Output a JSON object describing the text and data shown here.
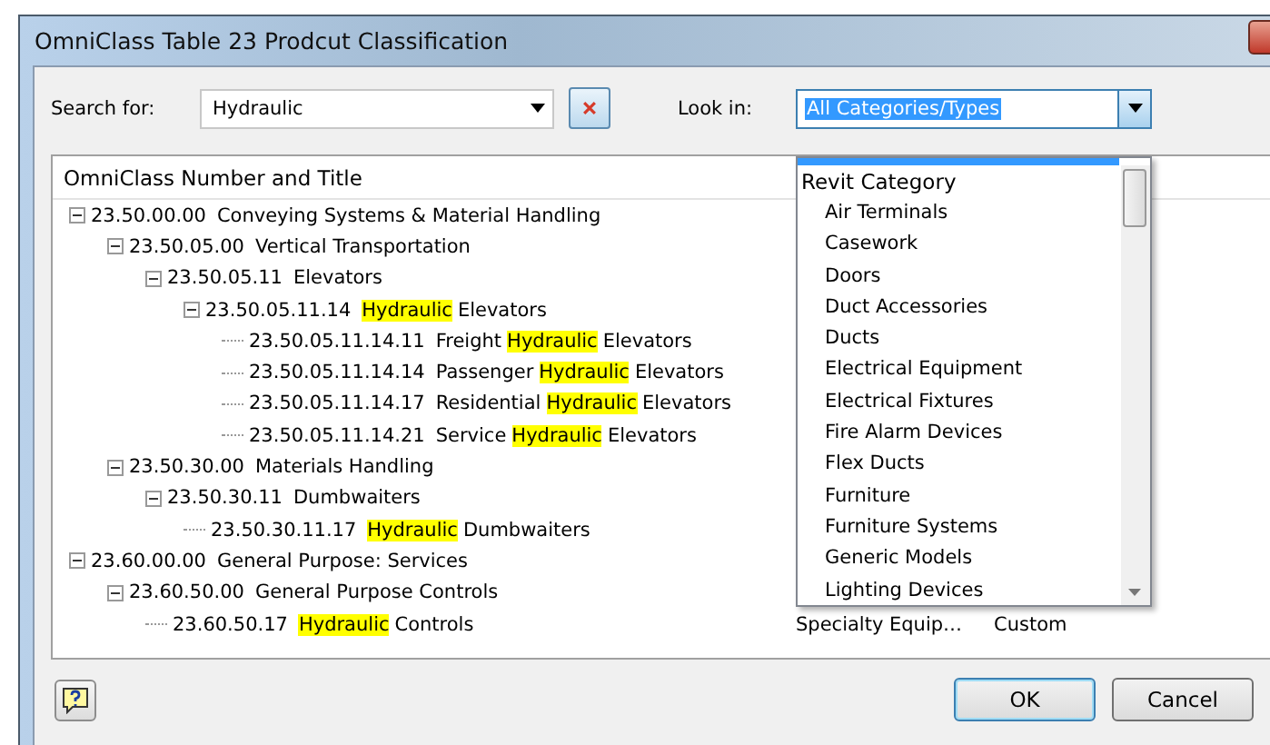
{
  "window": {
    "title": "OmniClass Table 23 Prodcut Classification"
  },
  "search": {
    "label": "Search for:",
    "value": "Hydraulic"
  },
  "look_in": {
    "label": "Look in:",
    "value": "All Categories/Types",
    "expanded": true
  },
  "tree": {
    "columns": [
      "OmniClass Number and Title"
    ],
    "items": [
      {
        "number": "23.50.00.00",
        "title": [
          {
            "text": "Conveying Systems & Material Handling",
            "highlighted": false
          }
        ],
        "expanded": true,
        "children": [
          {
            "number": "23.50.05.00",
            "title": [
              {
                "text": "Vertical Transportation",
                "highlighted": false
              }
            ],
            "expanded": true,
            "children": [
              {
                "number": "23.50.05.11",
                "title": [
                  {
                    "text": "Elevators",
                    "highlighted": false
                  }
                ],
                "expanded": true,
                "children": [
                  {
                    "number": "23.50.05.11.14",
                    "title": [
                      {
                        "text": "Hydraulic",
                        "highlighted": true
                      },
                      {
                        "text": "Elevators",
                        "highlighted": false
                      }
                    ],
                    "expanded": true,
                    "children": [
                      {
                        "number": "23.50.05.11.14.11",
                        "title": [
                          {
                            "text": "Freight",
                            "highlighted": false
                          },
                          {
                            "text": "Hydraulic",
                            "highlighted": true
                          },
                          {
                            "text": "Elevators",
                            "highlighted": false
                          }
                        ]
                      },
                      {
                        "number": "23.50.05.11.14.14",
                        "title": [
                          {
                            "text": "Passenger",
                            "highlighted": false
                          },
                          {
                            "text": "Hydraulic",
                            "highlighted": true
                          },
                          {
                            "text": "Elevators",
                            "highlighted": false
                          }
                        ]
                      },
                      {
                        "number": "23.50.05.11.14.17",
                        "title": [
                          {
                            "text": "Residential",
                            "highlighted": false
                          },
                          {
                            "text": "Hydraulic",
                            "highlighted": true
                          },
                          {
                            "text": "Elevators",
                            "highlighted": false
                          }
                        ]
                      },
                      {
                        "number": "23.50.05.11.14.21",
                        "title": [
                          {
                            "text": "Service",
                            "highlighted": false
                          },
                          {
                            "text": "Hydraulic",
                            "highlighted": true
                          },
                          {
                            "text": "Elevators",
                            "highlighted": false
                          }
                        ]
                      }
                    ]
                  }
                ]
              }
            ]
          },
          {
            "number": "23.50.30.00",
            "title": [
              {
                "text": "Materials Handling",
                "highlighted": false
              }
            ],
            "expanded": true,
            "children": [
              {
                "number": "23.50.30.11",
                "title": [
                  {
                    "text": "Dumbwaiters",
                    "highlighted": false
                  }
                ],
                "expanded": true,
                "children": [
                  {
                    "number": "23.50.30.11.17",
                    "title": [
                      {
                        "text": "Hydraulic",
                        "highlighted": true
                      },
                      {
                        "text": "Dumbwaiters",
                        "highlighted": false
                      }
                    ]
                  }
                ]
              }
            ]
          }
        ]
      },
      {
        "number": "23.60.00.00",
        "title": [
          {
            "text": "General Purpose: Services",
            "highlighted": false
          }
        ],
        "expanded": true,
        "children": [
          {
            "number": "23.60.50.00",
            "title": [
              {
                "text": "General Purpose Controls",
                "highlighted": false
              }
            ],
            "expanded": true,
            "children": [
              {
                "number": "23.60.50.17",
                "title": [
                  {
                    "text": "Hydraulic",
                    "highlighted": true
                  },
                  {
                    "text": "Controls",
                    "highlighted": false
                  }
                ],
                "column_2": "Specialty Equip…",
                "column_3": "Custom"
              }
            ]
          }
        ]
      }
    ]
  },
  "dropdown": {
    "group": "Revit Category",
    "items": [
      "Air Terminals",
      "Casework",
      "Doors",
      "Duct Accessories",
      "Ducts",
      "Electrical Equipment",
      "Electrical Fixtures",
      "Fire Alarm Devices",
      "Flex Ducts",
      "Furniture",
      "Furniture Systems",
      "Generic Models",
      "Lighting Devices"
    ]
  },
  "buttons": [
    {
      "kind": "help"
    },
    {
      "kind": "text",
      "label": "OK",
      "default": true
    },
    {
      "kind": "text",
      "label": "Cancel",
      "default": false
    }
  ]
}
